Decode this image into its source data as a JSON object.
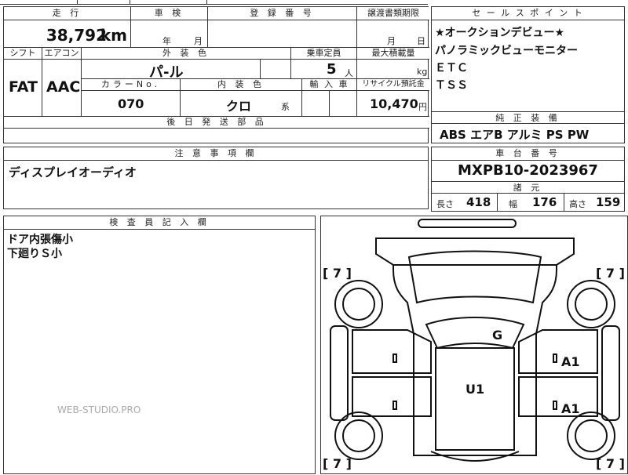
{
  "sheet": {
    "mileage_label": "走 行",
    "mileage_value": "38,792",
    "mileage_unit": "km",
    "inspection_label": "車 検",
    "inspection_year_unit": "年",
    "inspection_month_unit": "月",
    "registration_label": "登 録 番 号",
    "transfer_deadline_label": "譲渡書類期限",
    "transfer_month_unit": "月",
    "transfer_day_unit": "日",
    "shift_label": "シフト",
    "shift_value": "FAT",
    "aircon_label": "エアコン",
    "aircon_value": "AAC",
    "exterior_color_label": "外 装 色",
    "exterior_color_value": "パ-ル",
    "capacity_label": "乗車定員",
    "capacity_value": "5",
    "capacity_unit": "人",
    "max_load_label": "最大積載量",
    "max_load_unit": "kg",
    "color_no_label": "カラーNo.",
    "color_no_value": "070",
    "interior_color_label": "内 装 色",
    "interior_color_value": "クロ",
    "interior_color_suffix": "系",
    "import_label": "輸 入 車",
    "recycle_label": "リサイクル預託金",
    "recycle_value": "10,470",
    "recycle_unit": "円",
    "later_parts_label": "後 日 発 送 部 品",
    "notes_label": "注 意 事 項 欄",
    "notes_value": "ディスプレイオーディオ",
    "inspector_label": "検 査 員 記 入 欄",
    "inspector_lines": [
      "ドア内張傷小",
      "下廻りＳ小"
    ],
    "watermark": "WEB-STUDIO.PRO"
  },
  "sales_points": {
    "label": "セ ー ル ス ポ イ ン ト",
    "items": [
      "★オークションデビュー★",
      "パノラミックビューモニター",
      "ＥＴＣ",
      "ＴＳＳ"
    ]
  },
  "equipment": {
    "label": "純 正 装 備",
    "value": "ABS エアB アルミ PS PW"
  },
  "chassis": {
    "label": "車 台 番 号",
    "value": "MXPB10-2023967"
  },
  "specs": {
    "label": "諸 元",
    "length_label": "長さ",
    "length_value": "418",
    "width_label": "幅",
    "width_value": "176",
    "height_label": "高さ",
    "height_value": "159"
  },
  "diagram": {
    "marks": {
      "glass": "G",
      "door_right_front": "A1",
      "door_right_rear": "A1",
      "roof": "U1",
      "tire_fl": "7",
      "tire_fr": "7",
      "tire_rl": "7",
      "tire_rr": "7"
    }
  }
}
